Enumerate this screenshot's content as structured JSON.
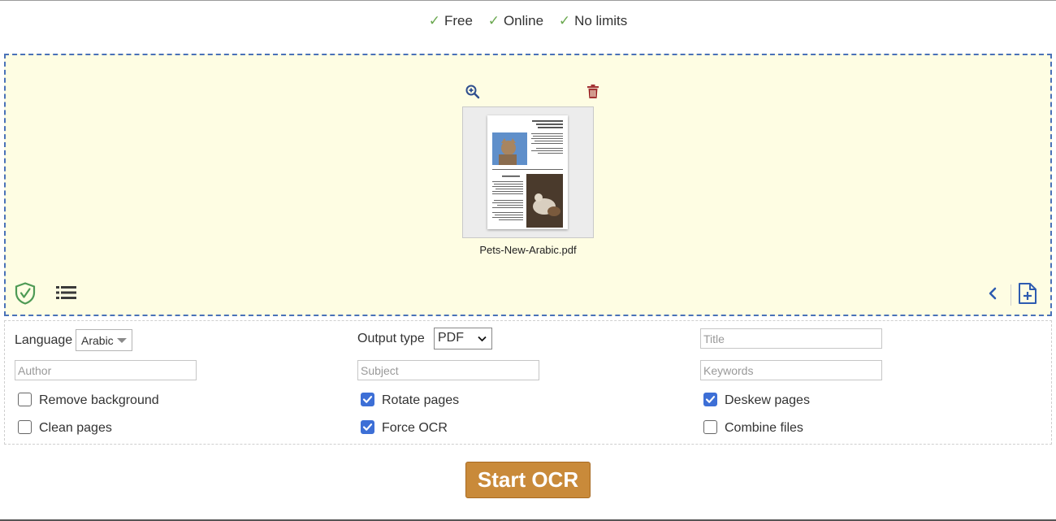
{
  "features": [
    "Free",
    "Online",
    "No limits"
  ],
  "upload": {
    "file_name": "Pets-New-Arabic.pdf"
  },
  "options": {
    "language_label": "Language",
    "language_value": "Arabic",
    "output_type_label": "Output type",
    "output_type_value": "PDF",
    "title_placeholder": "Title",
    "author_placeholder": "Author",
    "subject_placeholder": "Subject",
    "keywords_placeholder": "Keywords",
    "checkboxes": [
      {
        "label": "Remove background",
        "checked": false
      },
      {
        "label": "Rotate pages",
        "checked": true
      },
      {
        "label": "Deskew pages",
        "checked": true
      },
      {
        "label": "Clean pages",
        "checked": false
      },
      {
        "label": "Force OCR",
        "checked": true
      },
      {
        "label": "Combine files",
        "checked": false
      }
    ]
  },
  "actions": {
    "start_label": "Start OCR"
  },
  "colors": {
    "accent": "#c98a3a",
    "dropzone_bg": "#fefde3",
    "dropzone_border": "#4a72b8",
    "checkbox": "#3d6fd6",
    "check_mark": "#6aa84f"
  },
  "icons": [
    "zoom-in-icon",
    "trash-icon",
    "shield-check-icon",
    "list-icon",
    "chevron-left-icon",
    "add-file-icon"
  ]
}
